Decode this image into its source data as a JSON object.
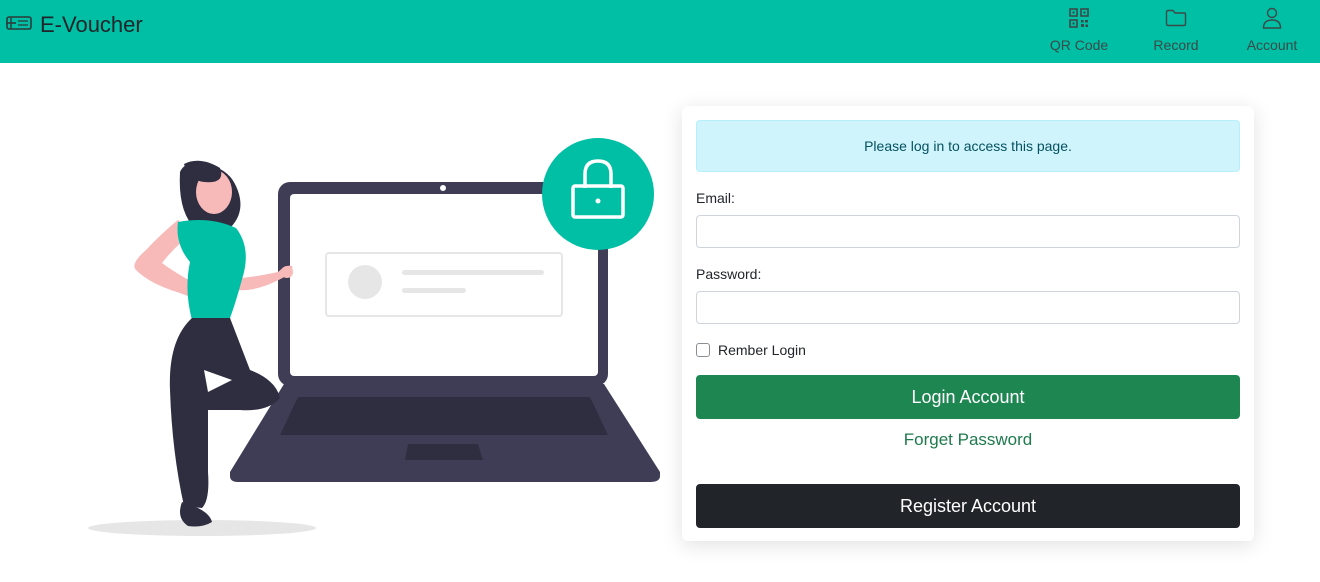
{
  "brand": {
    "title": "E-Voucher"
  },
  "nav": [
    {
      "label": "QR Code",
      "icon": "qr-code-icon"
    },
    {
      "label": "Record",
      "icon": "folder-icon"
    },
    {
      "label": "Account",
      "icon": "user-icon"
    }
  ],
  "login": {
    "alert": "Please log in to access this page.",
    "email_label": "Email:",
    "email_value": "",
    "password_label": "Password:",
    "password_value": "",
    "remember_label": "Rember Login",
    "login_button": "Login Account",
    "forget_link": "Forget Password",
    "register_button": "Register Account"
  },
  "colors": {
    "navbar": "#00bfa5",
    "login_button": "#1e8651",
    "register_button": "#212529",
    "alert_bg": "#cff4fc",
    "illustration_accent": "#00bfa5"
  }
}
